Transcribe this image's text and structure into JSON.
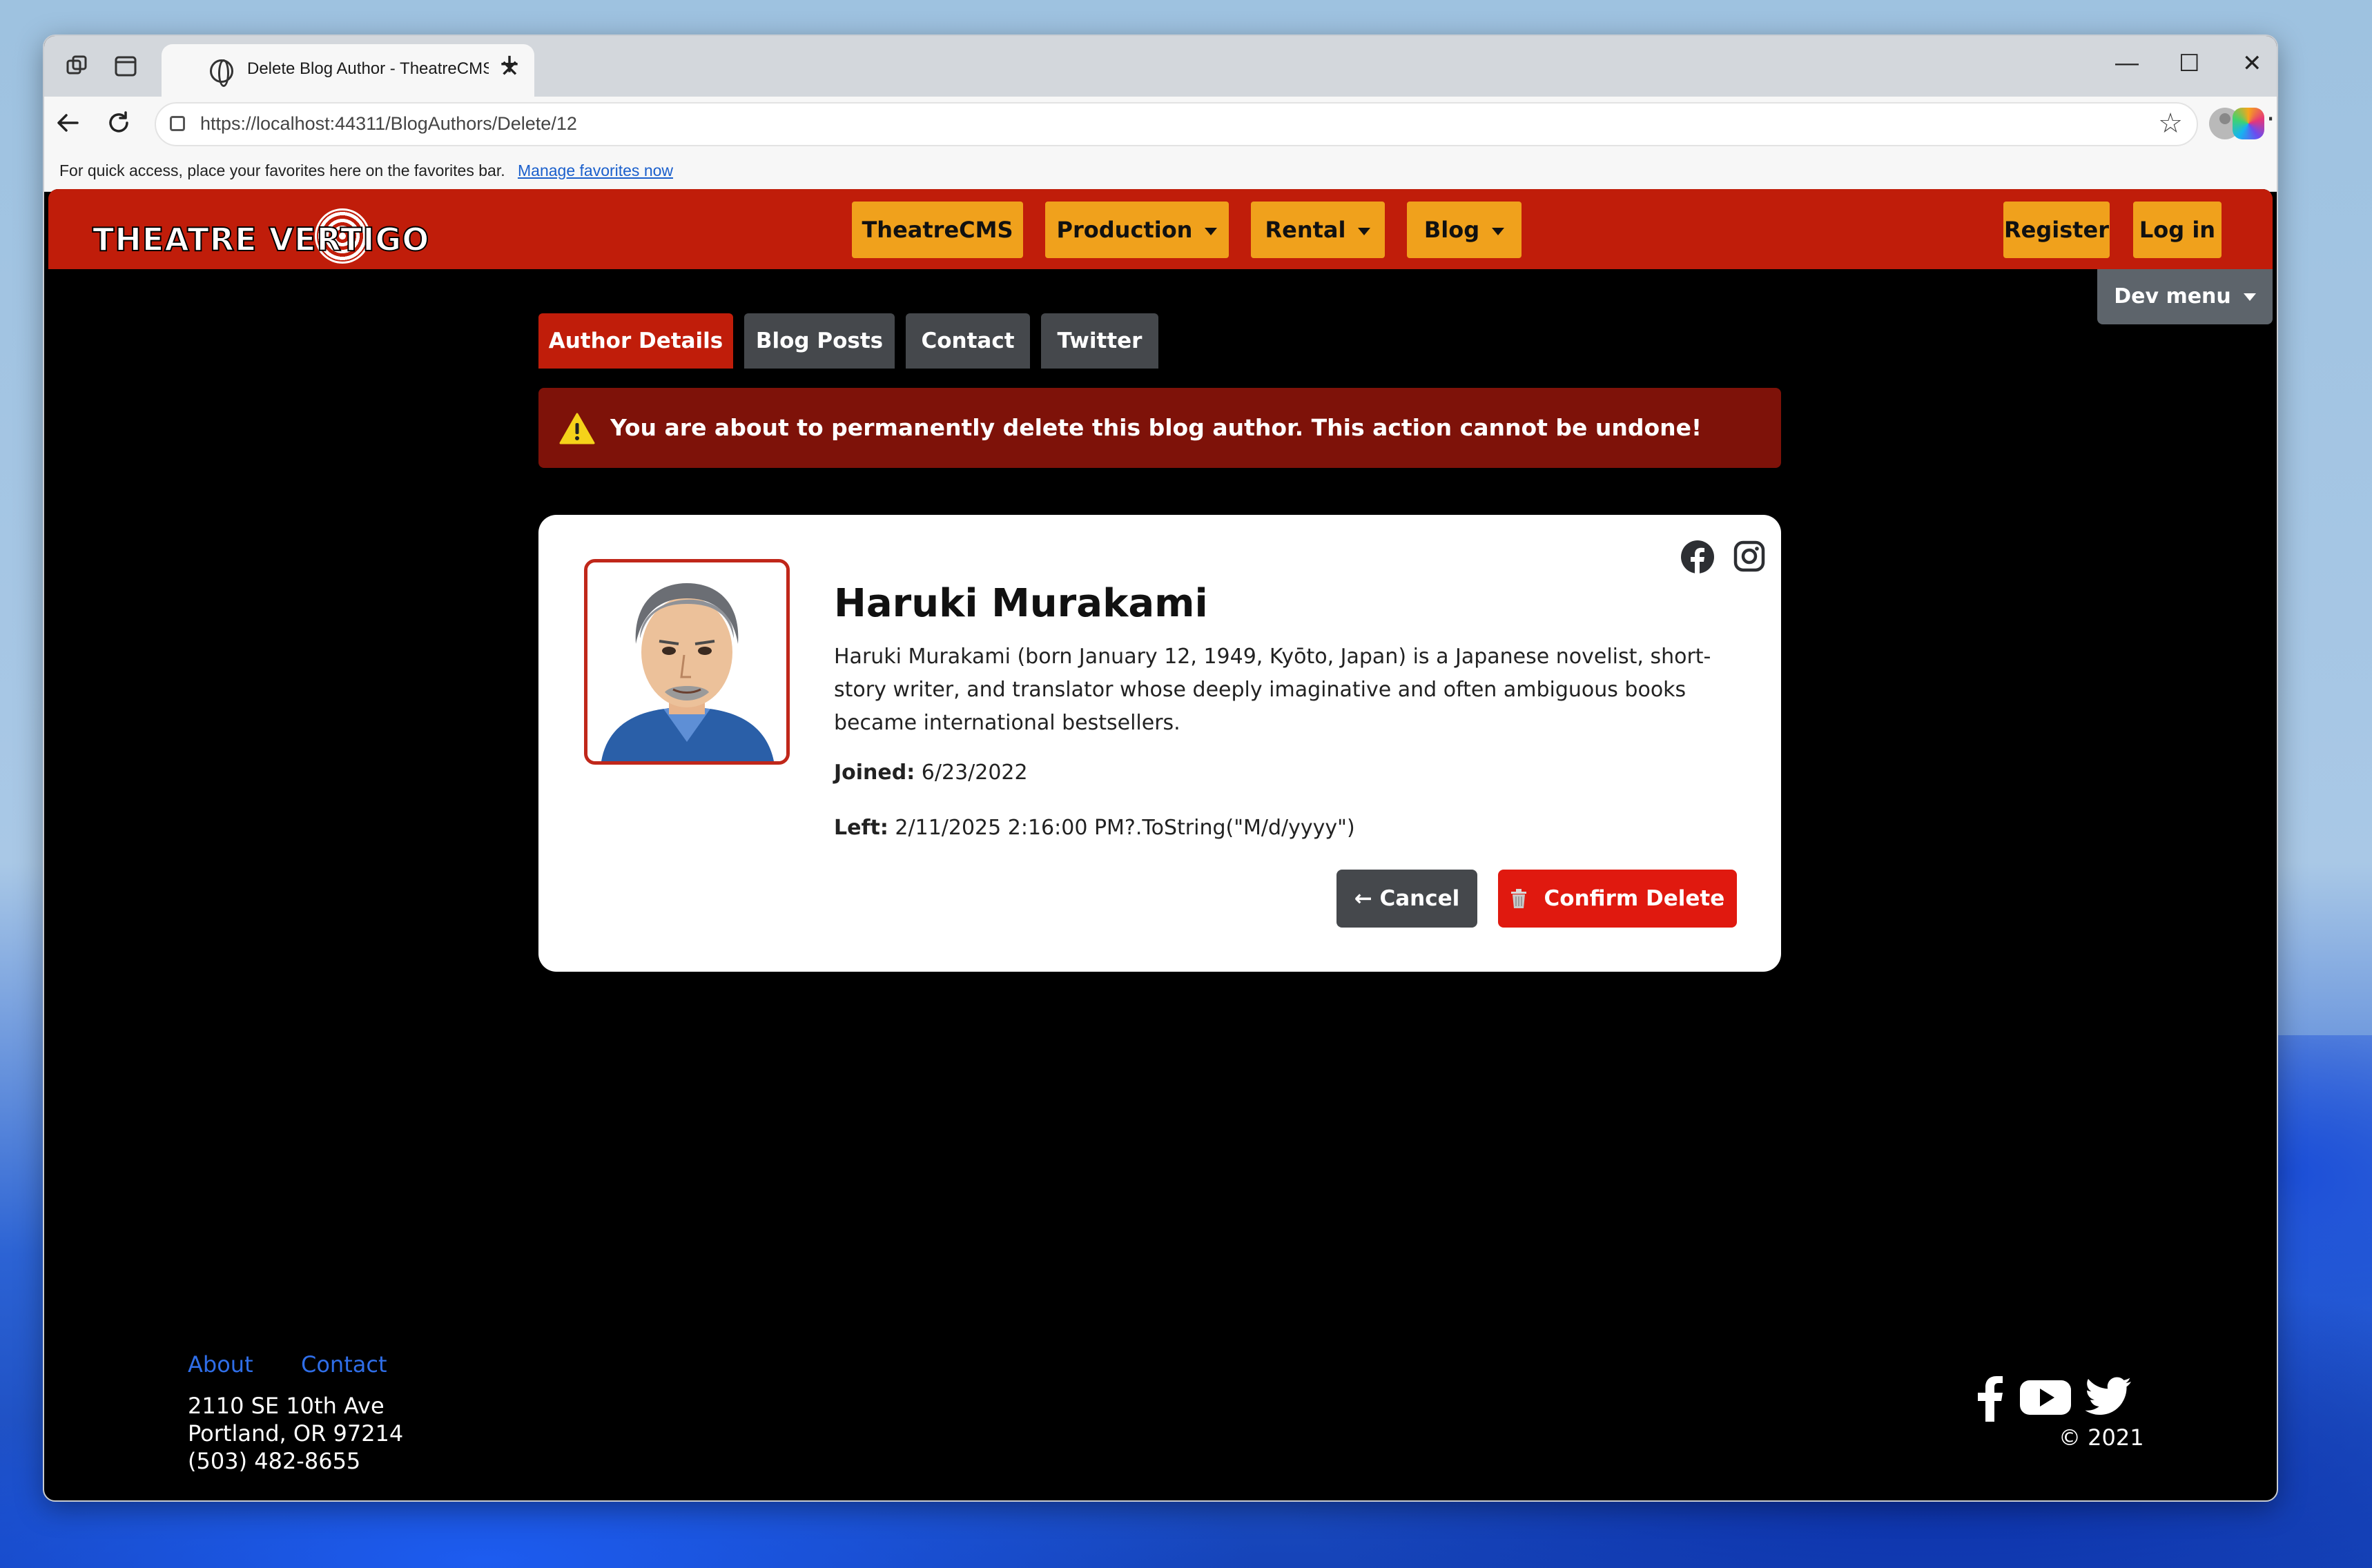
{
  "browser": {
    "tab_title": "Delete Blog Author - TheatreCMS",
    "tab_close": "✕",
    "new_tab": "+",
    "url": "https://localhost:44311/BlogAuthors/Delete/12",
    "favorites_text": "For quick access, place your favorites here on the favorites bar.",
    "favorites_link": "Manage favorites now",
    "minimize": "—",
    "maximize": "☐",
    "close": "✕"
  },
  "site": {
    "logo_text": "THEATRE VERTIGO",
    "nav": {
      "theatrecms": "TheatreCMS",
      "production": "Production",
      "rental": "Rental",
      "blog": "Blog",
      "register": "Register",
      "login": "Log in",
      "dev_menu": "Dev menu"
    },
    "brand_color": "#c01d0a",
    "accent_color": "#f0a11c"
  },
  "tabs": [
    {
      "label": "Author Details",
      "active": true
    },
    {
      "label": "Blog Posts",
      "active": false
    },
    {
      "label": "Contact",
      "active": false
    },
    {
      "label": "Twitter",
      "active": false
    }
  ],
  "alert": {
    "message": "You are about to permanently delete this blog author. This action cannot be undone!",
    "icon": "warning-triangle-icon"
  },
  "author": {
    "name": "Haruki Murakami",
    "bio": "Haruki Murakami (born January 12, 1949, Kyōto, Japan) is a Japanese novelist, short-story writer, and translator whose deeply imaginative and often ambiguous books became international bestsellers.",
    "joined_label": "Joined:",
    "joined_value": "6/23/2022",
    "left_label": "Left:",
    "left_value": "2/11/2025 2:16:00 PM?.ToString(\"M/d/yyyy\")",
    "social_icons": [
      "facebook-icon",
      "instagram-icon"
    ]
  },
  "actions": {
    "cancel": "← Cancel",
    "confirm_delete": "Confirm Delete"
  },
  "footer": {
    "about": "About",
    "contact": "Contact",
    "address_line1": "2110 SE 10th Ave",
    "address_line2": "Portland, OR 97214",
    "phone": "(503) 482-8655",
    "copyright": "© 2021",
    "social_icons": [
      "facebook-icon",
      "youtube-icon",
      "twitter-icon"
    ]
  }
}
